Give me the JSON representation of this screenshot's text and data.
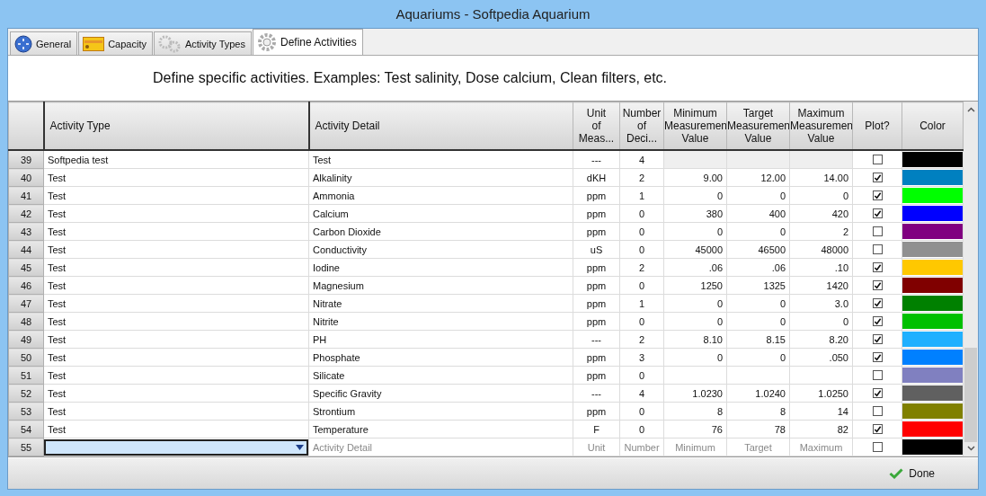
{
  "window": {
    "title": "Aquariums  -  Softpedia Aquarium"
  },
  "tabs": [
    {
      "label": "General",
      "kind": "globe",
      "selected": false
    },
    {
      "label": "Capacity",
      "kind": "card",
      "selected": false
    },
    {
      "label": "Activity Types",
      "kind": "gears",
      "selected": false
    },
    {
      "label": "Define Activities",
      "kind": "gear",
      "selected": true
    }
  ],
  "instruction": "Define specific activities.  Examples: Test salinity, Dose calcium, Clean filters, etc.",
  "table": {
    "columns": [
      "Activity Type",
      "Activity Detail",
      "Unit\nof\nMeas...",
      "Number\nof\nDeci...",
      "Minimum\nMeasuremen\nValue",
      "Target\nMeasuremen\nValue",
      "Maximum\nMeasuremen\nValue",
      "Plot?",
      "Color"
    ],
    "rows": [
      {
        "number": "39",
        "type": "Softpedia test",
        "detail": "Test",
        "unit": "---",
        "decimals": "4",
        "min": "",
        "target": "",
        "max": "",
        "disabled": true,
        "plot": false,
        "color": "#000000"
      },
      {
        "number": "40",
        "type": "Test",
        "detail": "Alkalinity",
        "unit": "dKH",
        "decimals": "2",
        "min": "9.00",
        "target": "12.00",
        "max": "14.00",
        "disabled": false,
        "plot": true,
        "color": "#0080c0"
      },
      {
        "number": "41",
        "type": "Test",
        "detail": "Ammonia",
        "unit": "ppm",
        "decimals": "1",
        "min": "0",
        "target": "0",
        "max": "0",
        "disabled": false,
        "plot": true,
        "color": "#00ff00"
      },
      {
        "number": "42",
        "type": "Test",
        "detail": "Calcium",
        "unit": "ppm",
        "decimals": "0",
        "min": "380",
        "target": "400",
        "max": "420",
        "disabled": false,
        "plot": true,
        "color": "#0000ff"
      },
      {
        "number": "43",
        "type": "Test",
        "detail": "Carbon Dioxide",
        "unit": "ppm",
        "decimals": "0",
        "min": "0",
        "target": "0",
        "max": "2",
        "disabled": false,
        "plot": false,
        "color": "#800080"
      },
      {
        "number": "44",
        "type": "Test",
        "detail": "Conductivity",
        "unit": "uS",
        "decimals": "0",
        "min": "45000",
        "target": "46500",
        "max": "48000",
        "disabled": false,
        "plot": false,
        "color": "#909090"
      },
      {
        "number": "45",
        "type": "Test",
        "detail": "Iodine",
        "unit": "ppm",
        "decimals": "2",
        "min": ".06",
        "target": ".06",
        "max": ".10",
        "disabled": false,
        "plot": true,
        "color": "#ffc800"
      },
      {
        "number": "46",
        "type": "Test",
        "detail": "Magnesium",
        "unit": "ppm",
        "decimals": "0",
        "min": "1250",
        "target": "1325",
        "max": "1420",
        "disabled": false,
        "plot": true,
        "color": "#800000"
      },
      {
        "number": "47",
        "type": "Test",
        "detail": "Nitrate",
        "unit": "ppm",
        "decimals": "1",
        "min": "0",
        "target": "0",
        "max": "3.0",
        "disabled": false,
        "plot": true,
        "color": "#008000"
      },
      {
        "number": "48",
        "type": "Test",
        "detail": "Nitrite",
        "unit": "ppm",
        "decimals": "0",
        "min": "0",
        "target": "0",
        "max": "0",
        "disabled": false,
        "plot": true,
        "color": "#00c000"
      },
      {
        "number": "49",
        "type": "Test",
        "detail": "PH",
        "unit": "---",
        "decimals": "2",
        "min": "8.10",
        "target": "8.15",
        "max": "8.20",
        "disabled": false,
        "plot": true,
        "color": "#20b0ff"
      },
      {
        "number": "50",
        "type": "Test",
        "detail": "Phosphate",
        "unit": "ppm",
        "decimals": "3",
        "min": "0",
        "target": "0",
        "max": ".050",
        "disabled": false,
        "plot": true,
        "color": "#0080ff"
      },
      {
        "number": "51",
        "type": "Test",
        "detail": "Silicate",
        "unit": "ppm",
        "decimals": "0",
        "min": "",
        "target": "",
        "max": "",
        "disabled": false,
        "plot": false,
        "color": "#8080c0"
      },
      {
        "number": "52",
        "type": "Test",
        "detail": "Specific Gravity",
        "unit": "---",
        "decimals": "4",
        "min": "1.0230",
        "target": "1.0240",
        "max": "1.0250",
        "disabled": false,
        "plot": true,
        "color": "#606060"
      },
      {
        "number": "53",
        "type": "Test",
        "detail": "Strontium",
        "unit": "ppm",
        "decimals": "0",
        "min": "8",
        "target": "8",
        "max": "14",
        "disabled": false,
        "plot": false,
        "color": "#808000"
      },
      {
        "number": "54",
        "type": "Test",
        "detail": "Temperature",
        "unit": "F",
        "decimals": "0",
        "min": "76",
        "target": "78",
        "max": "82",
        "disabled": false,
        "plot": true,
        "color": "#ff0000"
      }
    ],
    "new_row": {
      "number": "55",
      "detail_placeholder": "Activity Detail",
      "unit_placeholder": "Unit",
      "decimals_placeholder": "Number",
      "min_placeholder": "Minimum",
      "target_placeholder": "Target",
      "max_placeholder": "Maximum",
      "plot": false,
      "color": "#000000"
    }
  },
  "done_button": "Done"
}
